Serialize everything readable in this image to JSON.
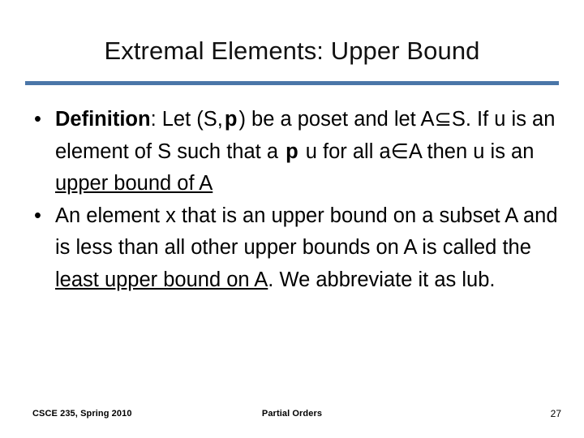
{
  "slide": {
    "title": "Extremal Elements: Upper Bound",
    "accent_color": "#4A76A8",
    "background_color": "#FFFFFF",
    "text_color": "#000000"
  },
  "body": {
    "bullet_marker": "•",
    "bullets": [
      {
        "id": "definition-bullet",
        "lead_label": "Definition",
        "segments": {
          "after_label": ": Let (S,",
          "relation_symbol": "p",
          "part_2": ") be a poset and let A⊆S.  If u is an element of S such that a ",
          "relation_symbol_2": "p",
          "part_3": " u for all a∈A then u is an ",
          "underlined": "upper bound of A"
        },
        "plain_text": "Definition: Let (S,p) be a poset and let A⊆S.  If u is an element of S such that a p u for all a∈A then u is an upper bound of A"
      },
      {
        "id": "lub-bullet",
        "segments": {
          "part_1": "An element x that is an upper bound on a subset A and is less than all other upper bounds on A is called the ",
          "underlined_1": "least upper bound on A",
          "part_2": ".  We abbreviate it as lub."
        },
        "plain_text": "An element x that is an upper bound on a subset A and is less than all other upper bounds on A is called the least upper bound on A.  We abbreviate it as lub."
      }
    ]
  },
  "footer": {
    "course": "CSCE 235, Spring 2010",
    "topic": "Partial Orders",
    "page_number": "27"
  }
}
